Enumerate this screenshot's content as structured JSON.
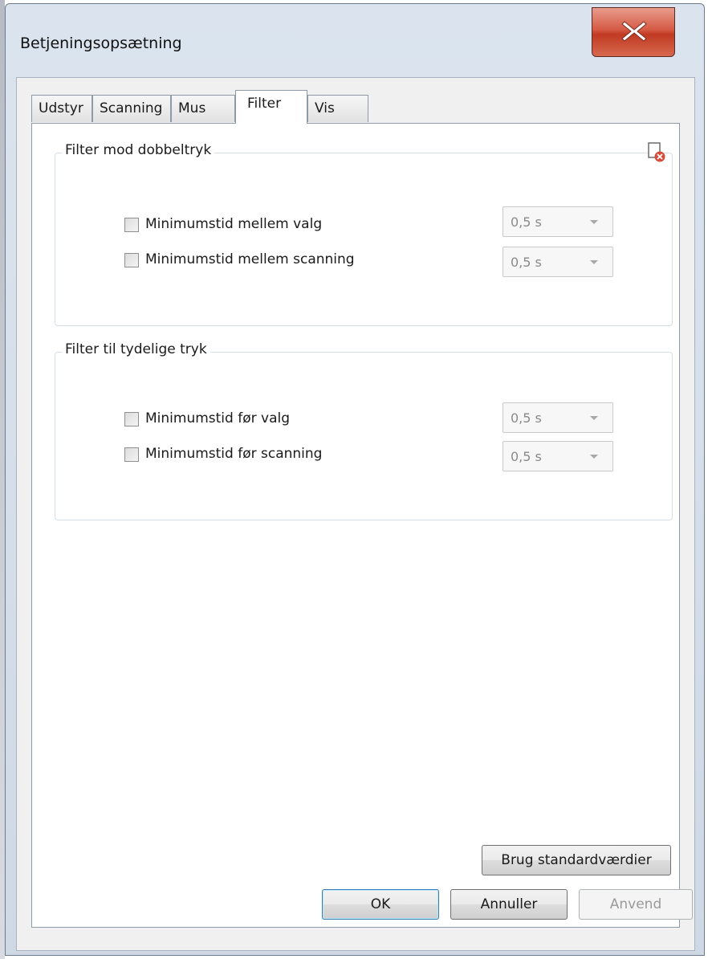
{
  "window": {
    "title": "Betjeningsopsætning"
  },
  "tabs": [
    {
      "label": "Udstyr",
      "active": false
    },
    {
      "label": "Scanning",
      "active": false
    },
    {
      "label": "Mus",
      "active": false
    },
    {
      "label": "Filter",
      "active": true
    },
    {
      "label": "Vis",
      "active": false
    }
  ],
  "groups": {
    "double_press": {
      "title": "Filter mod dobbeltryk",
      "rows": [
        {
          "label": "Minimumstid mellem valg",
          "checked": false,
          "value": "0,5 s"
        },
        {
          "label": "Minimumstid mellem scanning",
          "checked": false,
          "value": "0,5 s"
        }
      ]
    },
    "clear_press": {
      "title": "Filter til tydelige tryk",
      "rows": [
        {
          "label": "Minimumstid før valg",
          "checked": false,
          "value": "0,5 s"
        },
        {
          "label": "Minimumstid før scanning",
          "checked": false,
          "value": "0,5 s"
        }
      ]
    }
  },
  "buttons": {
    "defaults": "Brug standardværdier",
    "ok": "OK",
    "cancel": "Annuller",
    "apply": "Anvend"
  },
  "icons": {
    "close": "close-x-icon",
    "reset": "document-reset-icon"
  },
  "colors": {
    "close_button": "#c13a22",
    "panel_bg": "#ffffff",
    "dialog_bg": "#f0f0f0"
  }
}
